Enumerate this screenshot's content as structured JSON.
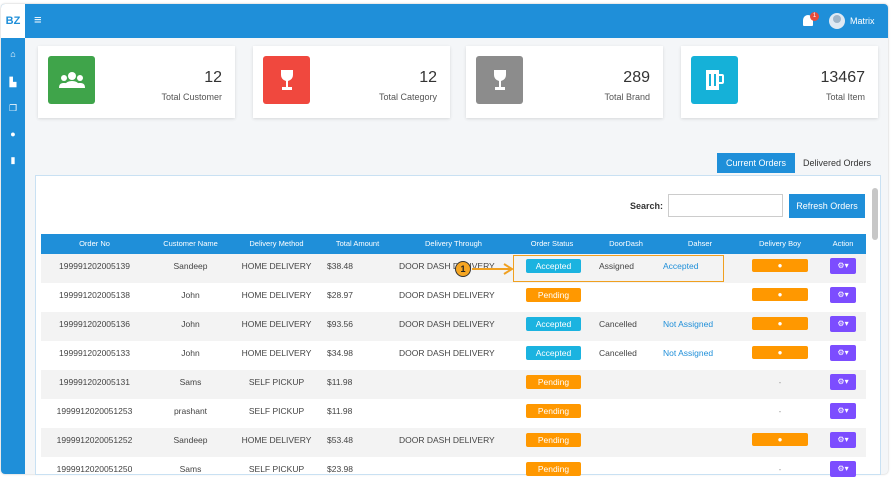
{
  "brand": "BZ",
  "header": {
    "menu_icon": "hamburger-icon",
    "notification_count": "1",
    "username": "Matrix"
  },
  "sidebar": {
    "items": [
      {
        "icon": "home-icon",
        "glyph": "⌂"
      },
      {
        "icon": "sitemap-icon",
        "glyph": "▙"
      },
      {
        "icon": "copy-icon",
        "glyph": "❐"
      },
      {
        "icon": "user-icon",
        "glyph": "●"
      },
      {
        "icon": "clipboard-icon",
        "glyph": "▮"
      }
    ]
  },
  "stats": [
    {
      "value": "12",
      "label": "Total Customer",
      "color": "#3fa44a",
      "icon": "users-icon",
      "glyph": "👥"
    },
    {
      "value": "12",
      "label": "Total Category",
      "color": "#f0483e",
      "icon": "wine-glass-icon",
      "glyph": "🍷"
    },
    {
      "value": "289",
      "label": "Total Brand",
      "color": "#8c8c8c",
      "icon": "wine-glass-icon",
      "glyph": "🍷"
    },
    {
      "value": "13467",
      "label": "Total Item",
      "color": "#15b1d8",
      "icon": "beer-mug-icon",
      "glyph": "🍺"
    }
  ],
  "tabs": {
    "current": "Current Orders",
    "delivered": "Delivered Orders"
  },
  "search": {
    "label": "Search:",
    "placeholder": ""
  },
  "refresh_label": "Refresh Orders",
  "columns": [
    "Order No",
    "Customer Name",
    "Delivery Method",
    "Total Amount",
    "Delivery Through",
    "Order Status",
    "DoorDash",
    "Dahser",
    "Delivery Boy",
    "Action"
  ],
  "rows": [
    {
      "order_no": "199991202005139",
      "customer": "Sandeep",
      "method": "HOME DELIVERY",
      "amount": "$38.48",
      "through": "DOOR DASH DELIVERY",
      "status": "Accepted",
      "doordash": "Assigned",
      "dasher": "Accepted",
      "dboy": "pin"
    },
    {
      "order_no": "199991202005138",
      "customer": "John",
      "method": "HOME DELIVERY",
      "amount": "$28.97",
      "through": "DOOR DASH DELIVERY",
      "status": "Pending",
      "doordash": "",
      "dasher": "",
      "dboy": "pin"
    },
    {
      "order_no": "199991202005136",
      "customer": "John",
      "method": "HOME DELIVERY",
      "amount": "$93.56",
      "through": "DOOR DASH DELIVERY",
      "status": "Accepted",
      "doordash": "Cancelled",
      "dasher": "Not Assigned",
      "dboy": "pin"
    },
    {
      "order_no": "199991202005133",
      "customer": "John",
      "method": "HOME DELIVERY",
      "amount": "$34.98",
      "through": "DOOR DASH DELIVERY",
      "status": "Accepted",
      "doordash": "Cancelled",
      "dasher": "Not Assigned",
      "dboy": "pin"
    },
    {
      "order_no": "199991202005131",
      "customer": "Sams",
      "method": "SELF PICKUP",
      "amount": "$11.98",
      "through": "",
      "status": "Pending",
      "doordash": "",
      "dasher": "",
      "dboy": "-"
    },
    {
      "order_no": "1999912020051253",
      "customer": "prashant",
      "method": "SELF PICKUP",
      "amount": "$11.98",
      "through": "",
      "status": "Pending",
      "doordash": "",
      "dasher": "",
      "dboy": "-"
    },
    {
      "order_no": "1999912020051252",
      "customer": "Sandeep",
      "method": "HOME DELIVERY",
      "amount": "$53.48",
      "through": "DOOR DASH DELIVERY",
      "status": "Pending",
      "doordash": "",
      "dasher": "",
      "dboy": "pin"
    },
    {
      "order_no": "1999912020051250",
      "customer": "Sams",
      "method": "SELF PICKUP",
      "amount": "$23.98",
      "through": "",
      "status": "Pending",
      "doordash": "",
      "dasher": "",
      "dboy": "-"
    }
  ],
  "annotation": {
    "marker": "1"
  },
  "colors": {
    "primary": "#1f8fd9",
    "accepted": "#1bb3e0",
    "pending": "#ff9800",
    "action": "#7c4dff"
  }
}
